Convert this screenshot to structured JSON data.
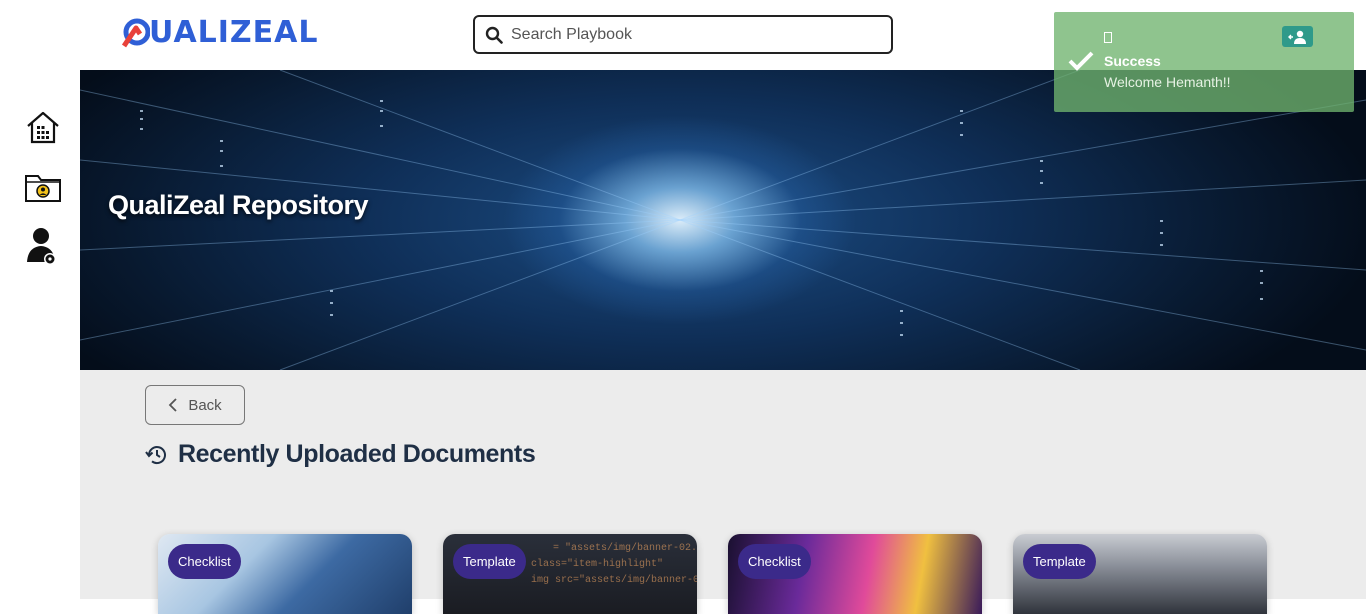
{
  "header": {
    "logo_text": "QUALIZEAL",
    "search": {
      "placeholder": "Search Playbook",
      "value": ""
    }
  },
  "sidebar": {
    "items": [
      {
        "icon": "home-grid-icon"
      },
      {
        "icon": "folder-user-icon"
      },
      {
        "icon": "user-settings-icon"
      }
    ]
  },
  "banner": {
    "title": "QualiZeal Repository"
  },
  "content": {
    "back_label": "Back",
    "section_title": "Recently Uploaded Documents",
    "cards": [
      {
        "badge": "Checklist"
      },
      {
        "badge": "Template"
      },
      {
        "badge": "Checklist"
      },
      {
        "badge": "Template"
      }
    ]
  },
  "toast": {
    "title": "Success",
    "message": "Welcome Hemanth!!"
  },
  "colors": {
    "brand_blue": "#2f5fd6",
    "brand_red": "#e8413a",
    "badge_purple": "#3b2a8a",
    "toast_green": "#70b46e",
    "heading": "#1f2f45"
  }
}
